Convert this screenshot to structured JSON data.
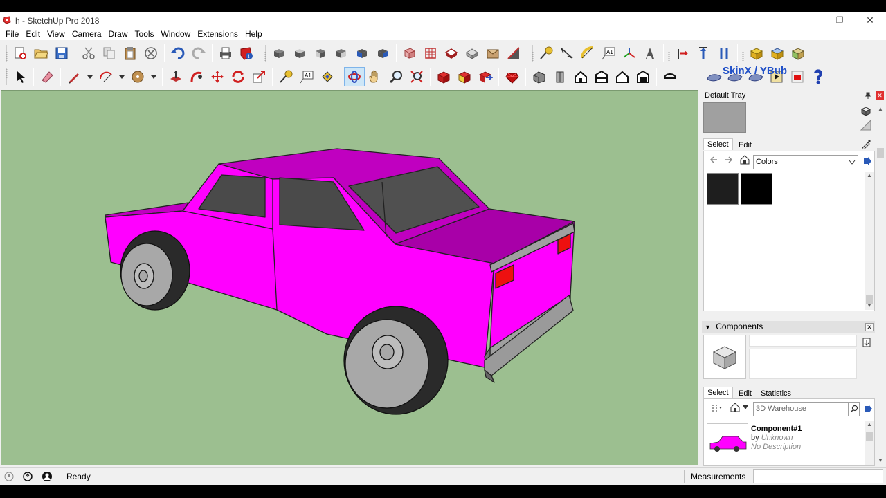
{
  "window": {
    "title": "h - SketchUp Pro 2018",
    "minimize": "—",
    "restore": "❐",
    "close": "✕"
  },
  "menu": [
    "File",
    "Edit",
    "View",
    "Camera",
    "Draw",
    "Tools",
    "Window",
    "Extensions",
    "Help"
  ],
  "toolbar": {
    "skin_label": "SkinX / YBub",
    "active_tool": "orbit"
  },
  "colors": {
    "viewport_bg": "#9cbf90",
    "car_body": "#ff00ff",
    "accent": "#2050c8"
  },
  "tray": {
    "title": "Default Tray",
    "materials": {
      "tabs": [
        "Select",
        "Edit"
      ],
      "active_tab": "Select",
      "library": "Colors",
      "swatches": [
        "#1e1e1e",
        "#000000"
      ]
    },
    "components": {
      "header": "Components",
      "tabs": [
        "Select",
        "Edit",
        "Statistics"
      ],
      "active_tab": "Select",
      "search_placeholder": "3D Warehouse",
      "item": {
        "name": "Component#1",
        "by_prefix": "by",
        "author": "Unknown",
        "description": "No Description"
      }
    }
  },
  "status": {
    "text": "Ready",
    "measurements_label": "Measurements",
    "measurements_value": ""
  }
}
